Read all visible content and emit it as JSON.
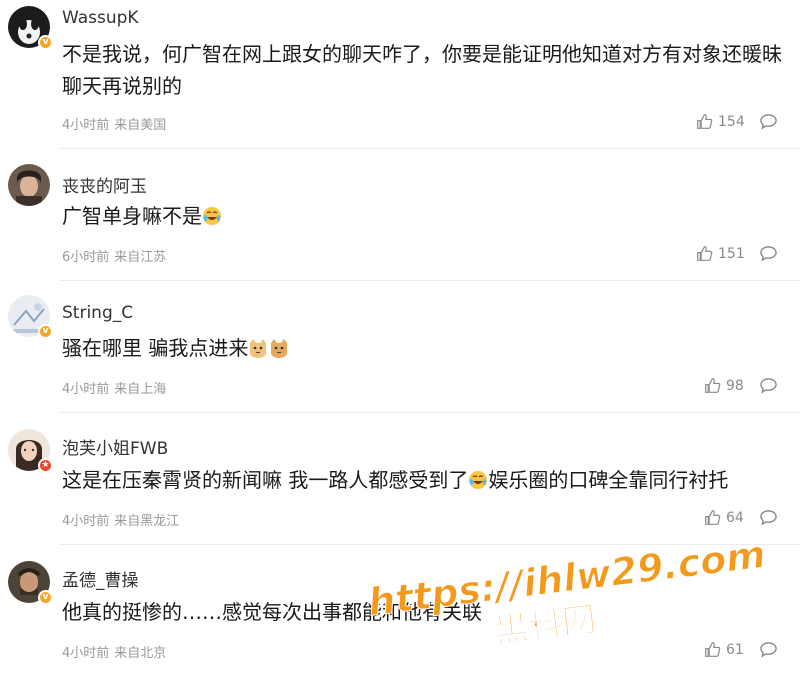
{
  "comments": [
    {
      "username": "WassupK",
      "text": "不是我说，何广智在网上跟女的聊天咋了，你要是能证明他知道对方有对象还暖昧聊天再说别的",
      "time": "4小时前",
      "location": "来自美国",
      "likes": "154",
      "badge": "vip"
    },
    {
      "username": "丧丧的阿玉",
      "text": "广智单身嘛不是",
      "emoji": "laugh-cry-emoji",
      "time": "6小时前",
      "location": "来自江苏",
      "likes": "151"
    },
    {
      "username": "String_C",
      "text": "骚在哪里 骗我点进来",
      "emoji": "cat-emoji",
      "time": "4小时前",
      "location": "来自上海",
      "likes": "98",
      "badge": "vip"
    },
    {
      "username": "泡芙小姐FWB",
      "text_before": "这是在压秦霄贤的新闻嘛 我一路人都感受到了",
      "text_after": "娱乐圈的口碑全靠同行衬托",
      "emoji": "laugh-cry-emoji",
      "time": "4小时前",
      "location": "来自黑龙江",
      "likes": "64",
      "badge": "red"
    },
    {
      "username": "孟德_曹操",
      "text": "他真的挺惨的……感觉每次出事都能和他有关联",
      "time": "4小时前",
      "location": "来自北京",
      "likes": "61",
      "badge": "vip"
    }
  ],
  "watermark": {
    "url": "https://ihlw29.com",
    "name": "黑料网"
  },
  "colors": {
    "watermark": "#f39a1c",
    "badge_vip": "#f5a623",
    "badge_red": "#e8462e",
    "meta": "#9a9a9a"
  }
}
